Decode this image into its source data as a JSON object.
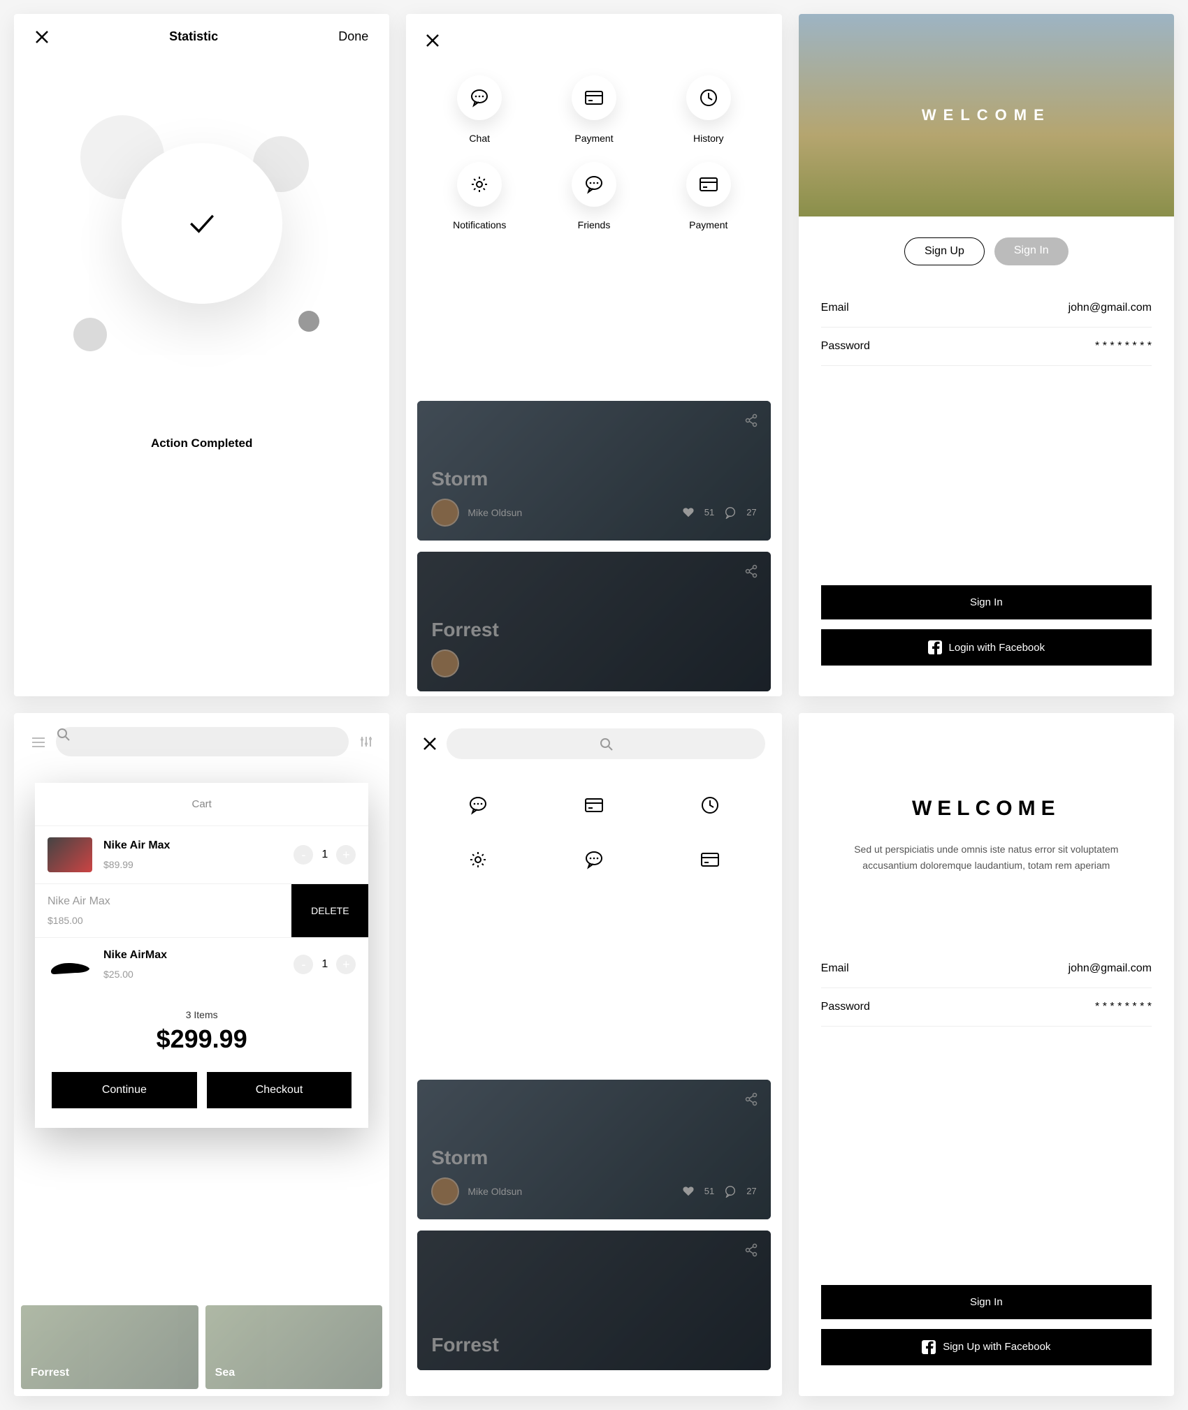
{
  "s1": {
    "title": "Statistic",
    "done": "Done",
    "msg": "Action Completed"
  },
  "s2": {
    "menu": [
      {
        "label": "Chat",
        "icon": "chat"
      },
      {
        "label": "Payment",
        "icon": "card"
      },
      {
        "label": "History",
        "icon": "clock"
      },
      {
        "label": "Notifications",
        "icon": "gear"
      },
      {
        "label": "Friends",
        "icon": "chat"
      },
      {
        "label": "Payment",
        "icon": "card"
      }
    ],
    "cards": [
      {
        "title": "Storm",
        "author": "Mike Oldsun",
        "likes": "51",
        "comments": "27"
      },
      {
        "title": "Forrest"
      }
    ]
  },
  "s3": {
    "welcome": "WELCOME",
    "tab1": "Sign Up",
    "tab2": "Sign In",
    "email_lbl": "Email",
    "email_val": "john@gmail.com",
    "pass_lbl": "Password",
    "pass_val": "* * * * * * * *",
    "btn1": "Sign In",
    "btn2": "Login with Facebook"
  },
  "s4": {
    "cart": "Cart",
    "items": [
      {
        "name": "Nike Air Max",
        "price": "$89.99",
        "qty": "1"
      },
      {
        "name": "Nike Air Max",
        "price": "$185.00",
        "delete": "DELETE"
      },
      {
        "name": "Nike AirMax",
        "price": "$25.00",
        "qty": "1"
      }
    ],
    "count": "3 Items",
    "total": "$299.99",
    "continue": "Continue",
    "checkout": "Checkout",
    "fc": [
      "Forrest",
      "Sea"
    ]
  },
  "s5": {
    "cards": [
      {
        "title": "Storm",
        "author": "Mike Oldsun",
        "likes": "51",
        "comments": "27"
      },
      {
        "title": "Forrest"
      }
    ]
  },
  "s6": {
    "welcome": "WELCOME",
    "desc": "Sed ut perspiciatis unde omnis iste natus error sit voluptatem accusantium doloremque laudantium, totam rem aperiam",
    "email_lbl": "Email",
    "email_val": "john@gmail.com",
    "pass_lbl": "Password",
    "pass_val": "* * * * * * * *",
    "btn1": "Sign In",
    "btn2": "Sign Up with Facebook"
  }
}
